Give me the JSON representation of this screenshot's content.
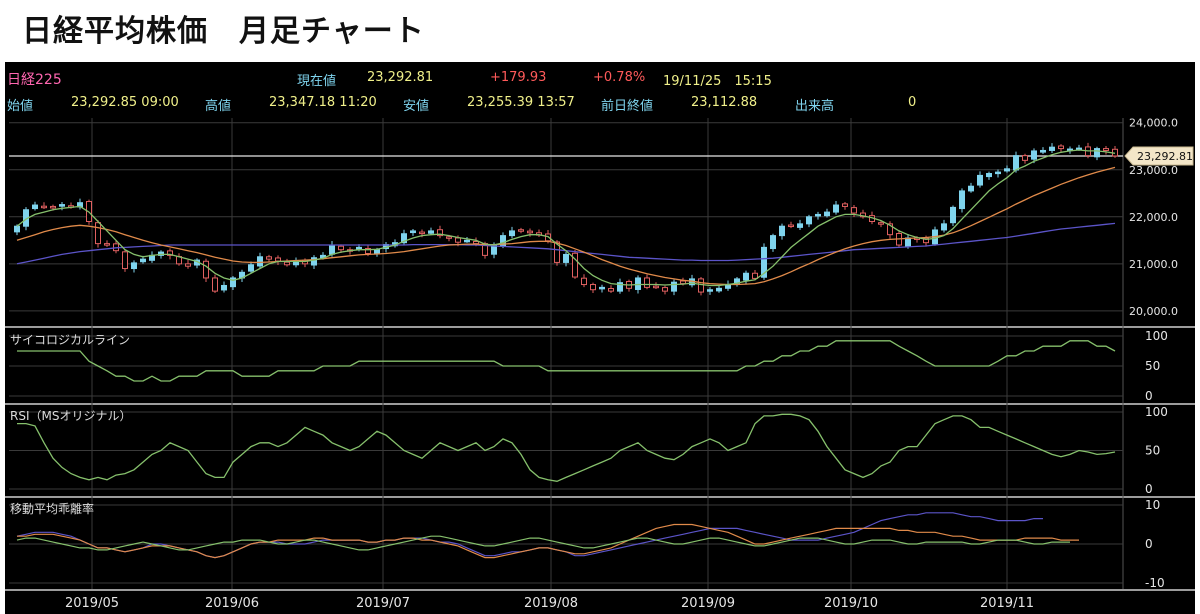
{
  "page": {
    "title": "日経平均株価　月足チャート"
  },
  "ticker": {
    "name": "日経225",
    "current_label": "現在値",
    "current": "23,292.81",
    "change": "+179.93",
    "change_pct": "+0.78%",
    "datetime": "19/11/25　15:15",
    "open_label": "始値",
    "open": "23,292.85 09:00",
    "high_label": "高値",
    "high": "23,347.18 11:20",
    "low_label": "安値",
    "low": "23,255.39 13:57",
    "prev_close_label": "前日終値",
    "prev_close": "23,112.88",
    "volume_label": "出来高",
    "volume": "0"
  },
  "colors": {
    "background": "#000000",
    "grid": "#3a3a3a",
    "up_candle": "#7fd4ee",
    "down_candle": "#e06060",
    "ma_short": "#86c06c",
    "ma_mid": "#e08a4a",
    "ma_long": "#5b54c8",
    "indicator_line": "#86c06c",
    "label_yellow": "#f0f08a",
    "label_red": "#ff5a5a",
    "label_cyan": "#7fd4ee",
    "label_pink": "#ff66b0"
  },
  "chart_data": [
    {
      "type": "candlestick",
      "title": "",
      "x_labels": [
        "2019/05",
        "2019/06",
        "2019/07",
        "2019/08",
        "2019/09",
        "2019/10",
        "2019/11"
      ],
      "y_ticks": [
        "24,000.0",
        "23,000.0",
        "22,000.0",
        "21,000.0",
        "20,000.0"
      ],
      "ylim": [
        19700,
        24100
      ],
      "last_price_tag": "23,292.81",
      "reference_line": 23292.81,
      "candles_close": [
        21800,
        22150,
        22250,
        22220,
        22200,
        22260,
        22210,
        22300,
        21900,
        21430,
        21400,
        21280,
        20900,
        21020,
        21100,
        21180,
        21250,
        21180,
        21000,
        20950,
        21080,
        20700,
        20420,
        20540,
        20700,
        20820,
        20980,
        21150,
        21100,
        21060,
        20980,
        21050,
        21000,
        21130,
        21180,
        21400,
        21300,
        21280,
        21350,
        21220,
        21300,
        21410,
        21450,
        21640,
        21700,
        21650,
        21700,
        21600,
        21550,
        21460,
        21500,
        21430,
        21180,
        21400,
        21600,
        21700,
        21720,
        21660,
        21610,
        21490,
        21030,
        21200,
        20720,
        20560,
        20450,
        20500,
        20420,
        20600,
        20480,
        20700,
        20500,
        20520,
        20420,
        20610,
        20580,
        20680,
        20400,
        20450,
        20480,
        20560,
        20680,
        20800,
        20690,
        21350,
        21600,
        21800,
        21800,
        21850,
        22000,
        22050,
        22100,
        22250,
        22220,
        22080,
        22000,
        21900,
        21850,
        21620,
        21400,
        21550,
        21520,
        21450,
        21720,
        21850,
        22200,
        22550,
        22650,
        22880,
        22920,
        22950,
        23020,
        23300,
        23200,
        23400,
        23410,
        23480,
        23450,
        23440,
        23460,
        23300,
        23450,
        23410,
        23293
      ],
      "ma_short": [
        21800,
        21950,
        22050,
        22100,
        22150,
        22180,
        22200,
        22220,
        22100,
        21900,
        21700,
        21500,
        21300,
        21200,
        21150,
        21180,
        21200,
        21200,
        21150,
        21100,
        21050,
        20950,
        20800,
        20700,
        20650,
        20700,
        20800,
        20900,
        21000,
        21050,
        21050,
        21050,
        21050,
        21080,
        21120,
        21200,
        21250,
        21280,
        21300,
        21300,
        21310,
        21350,
        21400,
        21480,
        21550,
        21600,
        21620,
        21630,
        21600,
        21560,
        21530,
        21500,
        21420,
        21400,
        21450,
        21520,
        21580,
        21620,
        21620,
        21580,
        21420,
        21280,
        21100,
        20900,
        20750,
        20650,
        20580,
        20560,
        20550,
        20560,
        20560,
        20560,
        20550,
        20560,
        20570,
        20590,
        20560,
        20540,
        20540,
        20560,
        20590,
        20630,
        20660,
        20800,
        20950,
        21150,
        21350,
        21500,
        21650,
        21800,
        21900,
        22000,
        22050,
        22050,
        22020,
        21980,
        21920,
        21820,
        21700,
        21620,
        21560,
        21520,
        21540,
        21600,
        21750,
        21950,
        22150,
        22350,
        22550,
        22700,
        22830,
        23000,
        23080,
        23180,
        23250,
        23320,
        23370,
        23400,
        23420,
        23400,
        23400,
        23380,
        23350
      ],
      "ma_mid": [
        21500,
        21560,
        21620,
        21680,
        21730,
        21770,
        21800,
        21820,
        21800,
        21770,
        21730,
        21680,
        21620,
        21560,
        21500,
        21450,
        21400,
        21360,
        21320,
        21280,
        21240,
        21190,
        21140,
        21100,
        21060,
        21040,
        21030,
        21030,
        21040,
        21050,
        21060,
        21070,
        21080,
        21090,
        21110,
        21130,
        21150,
        21170,
        21190,
        21200,
        21210,
        21220,
        21240,
        21260,
        21290,
        21320,
        21350,
        21380,
        21400,
        21410,
        21420,
        21420,
        21410,
        21410,
        21420,
        21430,
        21450,
        21470,
        21480,
        21480,
        21440,
        21390,
        21320,
        21250,
        21170,
        21090,
        21020,
        20950,
        20890,
        20840,
        20790,
        20750,
        20710,
        20680,
        20650,
        20630,
        20600,
        20580,
        20570,
        20560,
        20560,
        20570,
        20580,
        20620,
        20680,
        20750,
        20830,
        20920,
        21000,
        21090,
        21170,
        21250,
        21320,
        21380,
        21430,
        21470,
        21500,
        21520,
        21530,
        21540,
        21550,
        21560,
        21580,
        21610,
        21660,
        21730,
        21810,
        21900,
        21990,
        22080,
        22170,
        22270,
        22360,
        22450,
        22530,
        22610,
        22690,
        22760,
        22830,
        22890,
        22950,
        23000,
        23050
      ],
      "ma_long": [
        21000,
        21040,
        21080,
        21120,
        21160,
        21200,
        21230,
        21260,
        21280,
        21300,
        21320,
        21340,
        21350,
        21360,
        21370,
        21380,
        21390,
        21400,
        21400,
        21400,
        21400,
        21400,
        21400,
        21400,
        21400,
        21400,
        21400,
        21400,
        21400,
        21400,
        21400,
        21400,
        21400,
        21400,
        21400,
        21400,
        21400,
        21400,
        21400,
        21400,
        21400,
        21400,
        21400,
        21400,
        21410,
        21410,
        21410,
        21410,
        21410,
        21410,
        21400,
        21400,
        21390,
        21380,
        21370,
        21360,
        21350,
        21340,
        21330,
        21320,
        21300,
        21280,
        21260,
        21240,
        21220,
        21200,
        21180,
        21160,
        21140,
        21130,
        21120,
        21110,
        21100,
        21090,
        21080,
        21080,
        21070,
        21070,
        21070,
        21070,
        21080,
        21090,
        21100,
        21110,
        21120,
        21140,
        21160,
        21180,
        21200,
        21220,
        21240,
        21260,
        21280,
        21300,
        21310,
        21320,
        21330,
        21340,
        21350,
        21360,
        21370,
        21380,
        21400,
        21420,
        21440,
        21460,
        21480,
        21500,
        21520,
        21540,
        21560,
        21590,
        21620,
        21650,
        21680,
        21710,
        21740,
        21760,
        21780,
        21800,
        21820,
        21840,
        21860
      ]
    },
    {
      "type": "line",
      "title": "サイコロジカルライン",
      "y_ticks": [
        "100",
        "50",
        "0"
      ],
      "ylim": [
        0,
        100
      ],
      "values": [
        75,
        75,
        75,
        75,
        75,
        75,
        75,
        75,
        58,
        50,
        42,
        33,
        33,
        25,
        25,
        33,
        25,
        25,
        33,
        33,
        33,
        42,
        42,
        42,
        42,
        33,
        33,
        33,
        33,
        42,
        42,
        42,
        42,
        42,
        50,
        50,
        50,
        50,
        58,
        58,
        58,
        58,
        58,
        58,
        58,
        58,
        58,
        58,
        58,
        58,
        58,
        58,
        58,
        58,
        50,
        50,
        50,
        50,
        50,
        42,
        42,
        42,
        42,
        42,
        42,
        42,
        42,
        42,
        42,
        42,
        42,
        42,
        42,
        42,
        42,
        42,
        42,
        42,
        42,
        42,
        42,
        50,
        50,
        58,
        58,
        67,
        67,
        75,
        75,
        83,
        83,
        92,
        92,
        92,
        92,
        92,
        92,
        92,
        83,
        75,
        67,
        58,
        50,
        50,
        50,
        50,
        50,
        50,
        50,
        58,
        67,
        67,
        75,
        75,
        83,
        83,
        83,
        92,
        92,
        92,
        83,
        83,
        75
      ]
    },
    {
      "type": "line",
      "title": "RSI（MSオリジナル）",
      "y_ticks": [
        "100",
        "50",
        "0"
      ],
      "ylim": [
        0,
        100
      ],
      "values": [
        85,
        85,
        82,
        60,
        40,
        28,
        20,
        15,
        12,
        15,
        12,
        18,
        20,
        25,
        35,
        45,
        50,
        60,
        55,
        50,
        35,
        20,
        15,
        15,
        35,
        45,
        55,
        60,
        60,
        55,
        60,
        70,
        80,
        75,
        70,
        60,
        55,
        50,
        55,
        65,
        75,
        70,
        60,
        50,
        45,
        40,
        50,
        60,
        55,
        50,
        55,
        60,
        50,
        55,
        65,
        60,
        45,
        25,
        15,
        12,
        10,
        15,
        20,
        25,
        30,
        35,
        40,
        50,
        55,
        60,
        50,
        45,
        40,
        38,
        45,
        55,
        60,
        65,
        60,
        50,
        55,
        60,
        85,
        95,
        95,
        97,
        97,
        95,
        90,
        75,
        55,
        40,
        25,
        20,
        15,
        20,
        30,
        35,
        50,
        55,
        55,
        70,
        85,
        90,
        95,
        95,
        90,
        80,
        80,
        75,
        70,
        65,
        60,
        55,
        50,
        45,
        42,
        45,
        50,
        48,
        45,
        46,
        48
      ]
    },
    {
      "type": "line",
      "title": "移動平均乖離率",
      "y_ticks": [
        "10",
        "0",
        "-10"
      ],
      "ylim": [
        -10,
        10
      ],
      "series": [
        {
          "values": [
            2,
            2.5,
            3,
            3,
            3,
            2.5,
            2,
            1,
            0,
            -1,
            -1,
            -1.5,
            -2,
            -1.5,
            -1,
            0,
            0,
            -0.5,
            -1,
            -1.5,
            -2,
            -3,
            -3.5,
            -3,
            -2,
            -1,
            0,
            0.5,
            0.5,
            0.5,
            0,
            0,
            0,
            0.5,
            1,
            1,
            1,
            1,
            1,
            0.5,
            0.5,
            1,
            1,
            1.5,
            1.5,
            1.5,
            1,
            0.5,
            0.5,
            0,
            -1,
            -2,
            -3,
            -3,
            -2.5,
            -2,
            -2,
            -1.5,
            -1,
            -1,
            -1.5,
            -2,
            -3,
            -3,
            -2.5,
            -2,
            -1.5,
            -1,
            -0.5,
            0,
            0.5,
            1,
            1.5,
            2,
            2.5,
            3,
            3.5,
            4,
            4,
            4,
            4,
            3.5,
            3,
            2.5,
            2,
            1.5,
            1,
            1,
            1,
            1,
            1.5,
            2,
            2.5,
            3,
            4,
            5,
            6,
            6.5,
            7,
            7.5,
            7.5,
            8,
            8,
            8,
            8,
            7.5,
            7,
            7,
            6.5,
            6,
            6,
            6,
            6,
            6.5,
            6.5
          ]
        },
        {
          "values": [
            2,
            2,
            2.5,
            2.5,
            2.5,
            2,
            1.5,
            1,
            0,
            -1,
            -1,
            -1.5,
            -2,
            -1.5,
            -1,
            -0.5,
            -0.5,
            -0.5,
            -1,
            -1.5,
            -2,
            -3,
            -3.5,
            -3,
            -2,
            -1,
            0,
            0.5,
            0.5,
            1,
            1,
            1,
            1,
            1.5,
            1.5,
            1,
            1,
            1,
            1,
            0.5,
            0.5,
            1,
            1,
            1.5,
            1.5,
            1,
            1,
            0.5,
            0,
            -0.5,
            -1.5,
            -2.5,
            -3.5,
            -3.5,
            -3,
            -2.5,
            -2,
            -1.5,
            -1,
            -1,
            -1.5,
            -2,
            -2.5,
            -2.5,
            -2,
            -1.5,
            -1,
            0,
            1,
            2,
            3,
            4,
            4.5,
            5,
            5,
            5,
            4.5,
            4,
            3.5,
            3,
            2,
            1,
            0,
            0,
            0.5,
            1,
            1.5,
            2,
            2.5,
            3,
            3.5,
            4,
            4,
            4,
            4,
            4,
            4,
            4,
            3.5,
            3.5,
            3,
            3,
            3,
            2.5,
            2,
            2,
            1.5,
            1,
            1,
            1,
            1,
            1,
            1.5,
            1.5,
            1.5,
            1.5,
            1,
            1,
            1
          ]
        },
        {
          "values": [
            1,
            1.5,
            1.5,
            1,
            0.5,
            0,
            -0.5,
            -1,
            -1,
            -1.5,
            -1.5,
            -1,
            -0.5,
            0,
            0.5,
            0,
            -0.5,
            -1,
            -1.5,
            -1.5,
            -1,
            -0.5,
            0,
            0.5,
            0.5,
            1,
            1,
            1,
            0.5,
            0,
            0,
            0.5,
            1,
            1,
            0.5,
            0,
            -0.5,
            -1,
            -1.5,
            -1.5,
            -1,
            -0.5,
            0,
            0.5,
            1,
            1.5,
            2,
            2,
            1.5,
            1,
            0.5,
            0,
            -0.5,
            -0.5,
            0,
            0.5,
            1,
            1.5,
            1.5,
            1,
            0.5,
            0,
            -0.5,
            -1,
            -1,
            -0.5,
            0,
            0.5,
            1,
            1.5,
            1.5,
            1,
            0.5,
            0,
            0,
            0.5,
            1,
            1.5,
            1.5,
            1,
            0.5,
            0,
            -0.5,
            -0.5,
            0,
            0.5,
            1,
            1.5,
            1.5,
            1.5,
            1,
            0.5,
            0,
            0,
            0.5,
            1,
            1,
            1,
            0.5,
            0,
            0,
            0.5,
            0.5,
            0.5,
            0.5,
            0.5,
            0,
            0,
            0.5,
            1,
            1,
            1,
            0.5,
            0,
            0,
            0.5,
            0.5,
            0.5
          ]
        }
      ]
    }
  ]
}
